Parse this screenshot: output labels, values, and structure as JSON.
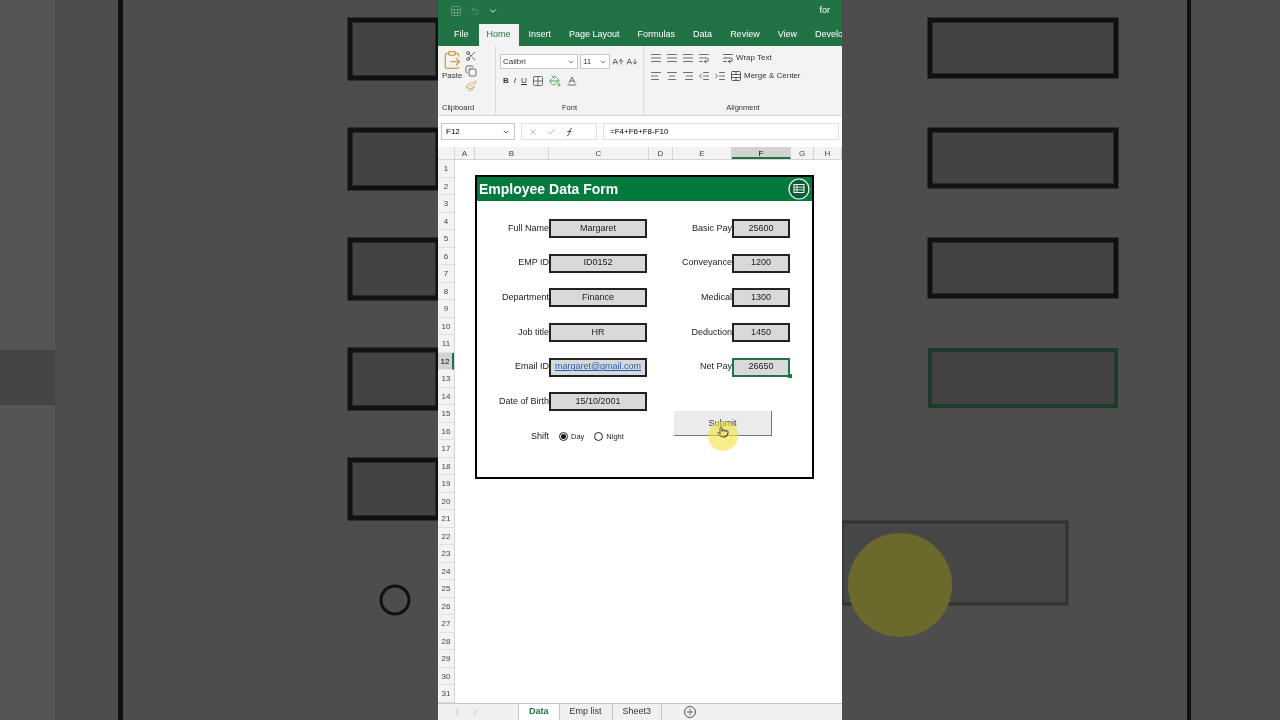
{
  "title_bar": {
    "title": "for"
  },
  "ribbon_tabs": [
    {
      "label": "File",
      "selected": false
    },
    {
      "label": "Home",
      "selected": true
    },
    {
      "label": "Insert",
      "selected": false
    },
    {
      "label": "Page Layout",
      "selected": false
    },
    {
      "label": "Formulas",
      "selected": false
    },
    {
      "label": "Data",
      "selected": false
    },
    {
      "label": "Review",
      "selected": false
    },
    {
      "label": "View",
      "selected": false
    },
    {
      "label": "Develo",
      "selected": false
    }
  ],
  "ribbon": {
    "paste_label": "Paste",
    "font_name": "Calibri",
    "font_size": "11",
    "style_buttons": [
      "B",
      "I",
      "U"
    ],
    "wrap_text": "Wrap Text",
    "merge_center": "Merge & Center",
    "groups": [
      "Clipboard",
      "Font",
      "Alignment"
    ]
  },
  "formula_bar": {
    "name_box": "F12",
    "formula": "=F4+F6+F8-F10"
  },
  "columns": [
    {
      "label": "A",
      "selected": false
    },
    {
      "label": "B",
      "selected": false
    },
    {
      "label": "C",
      "selected": false
    },
    {
      "label": "D",
      "selected": false
    },
    {
      "label": "E",
      "selected": false
    },
    {
      "label": "F",
      "selected": true
    },
    {
      "label": "G",
      "selected": false
    },
    {
      "label": "H",
      "selected": false
    }
  ],
  "rows": [
    {
      "label": "1",
      "selected": false
    },
    {
      "label": "2",
      "selected": false
    },
    {
      "label": "3",
      "selected": false
    },
    {
      "label": "4",
      "selected": false
    },
    {
      "label": "5",
      "selected": false
    },
    {
      "label": "6",
      "selected": false
    },
    {
      "label": "7",
      "selected": false
    },
    {
      "label": "8",
      "selected": false
    },
    {
      "label": "9",
      "selected": false
    },
    {
      "label": "10",
      "selected": false
    },
    {
      "label": "11",
      "selected": false
    },
    {
      "label": "12",
      "selected": true
    },
    {
      "label": "13",
      "selected": false
    },
    {
      "label": "14",
      "selected": false
    },
    {
      "label": "15",
      "selected": false
    },
    {
      "label": "16",
      "selected": false
    },
    {
      "label": "17",
      "selected": false
    },
    {
      "label": "18",
      "selected": false
    },
    {
      "label": "19",
      "selected": false
    },
    {
      "label": "20",
      "selected": false
    },
    {
      "label": "21",
      "selected": false
    },
    {
      "label": "22",
      "selected": false
    },
    {
      "label": "23",
      "selected": false
    },
    {
      "label": "24",
      "selected": false
    },
    {
      "label": "25",
      "selected": false
    },
    {
      "label": "26",
      "selected": false
    },
    {
      "label": "27",
      "selected": false
    },
    {
      "label": "28",
      "selected": false
    },
    {
      "label": "29",
      "selected": false
    },
    {
      "label": "30",
      "selected": false
    },
    {
      "label": "31",
      "selected": false
    }
  ],
  "form": {
    "title": "Employee Data Form",
    "left_fields": [
      {
        "label": "Full Name",
        "value": "Margaret",
        "kind": "text"
      },
      {
        "label": "EMP ID",
        "value": "ID0152",
        "kind": "text"
      },
      {
        "label": "Department",
        "value": "Finance",
        "kind": "text"
      },
      {
        "label": "Job title",
        "value": "HR",
        "kind": "text"
      },
      {
        "label": "Email ID",
        "value": "margaret@gmail.com",
        "kind": "link"
      },
      {
        "label": "Date of Birth",
        "value": "15/10/2001",
        "kind": "text"
      }
    ],
    "right_fields": [
      {
        "label": "Basic Pay",
        "value": "25600",
        "selected": false
      },
      {
        "label": "Conveyance",
        "value": "1200",
        "selected": false
      },
      {
        "label": "Medical",
        "value": "1300",
        "selected": false
      },
      {
        "label": "Deduction",
        "value": "1450",
        "selected": false
      },
      {
        "label": "Net Pay",
        "value": "26650",
        "selected": true
      }
    ],
    "shift": {
      "label": "Shift",
      "options": [
        {
          "label": "Day",
          "selected": true
        },
        {
          "label": "Night",
          "selected": false
        }
      ]
    },
    "submit": "Submit"
  },
  "sheet_tabs": [
    {
      "label": "Data",
      "selected": true
    },
    {
      "label": "Emp list",
      "selected": false
    },
    {
      "label": "Sheet3",
      "selected": false
    }
  ]
}
